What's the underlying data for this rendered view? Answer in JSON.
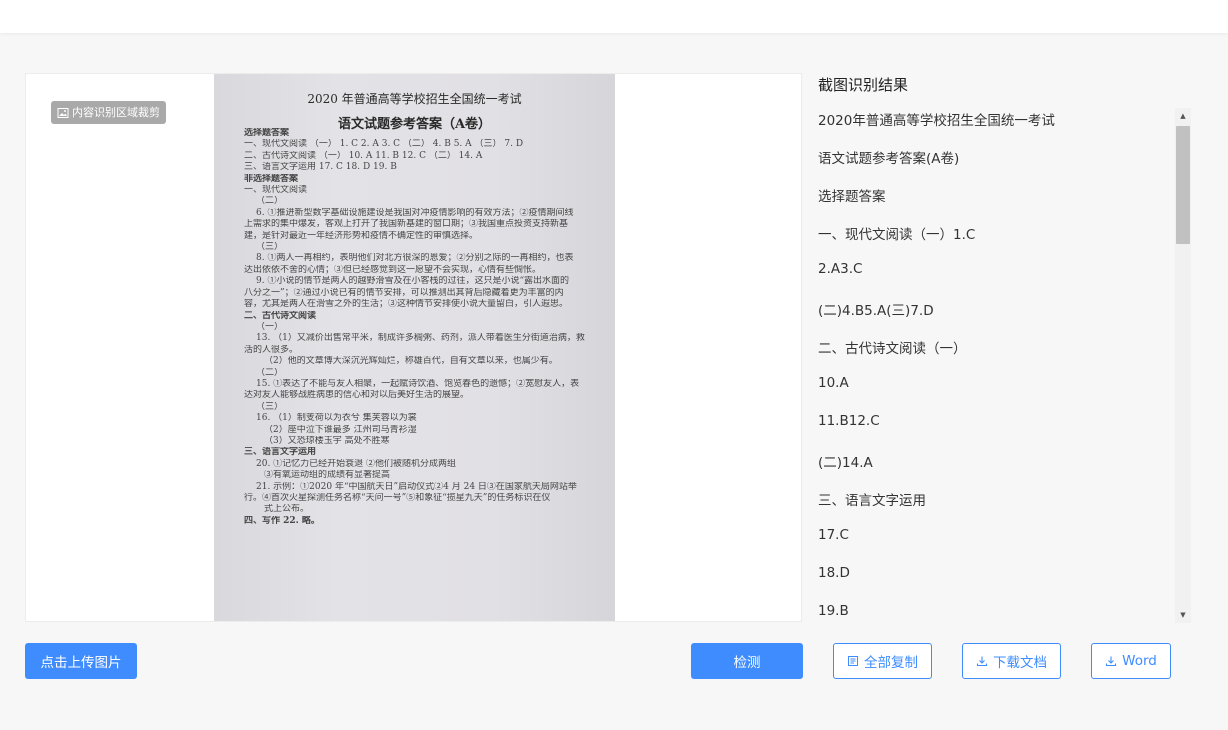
{
  "crop_badge": {
    "label": "内容识别区域裁剪",
    "icon": "image-icon"
  },
  "paper": {
    "title_1": "2020 年普通高等学校招生全国统一考试",
    "title_2": "语文试题参考答案（A卷）",
    "lines": [
      {
        "text": "选择题答案",
        "style": "h"
      },
      {
        "text": "一、现代文阅读 （一） 1. C   2. A   3. C   （二） 4. B   5. A     （三） 7. D",
        "style": ""
      },
      {
        "text": "二、古代诗文阅读 （一） 10. A     11. B     12. C     （二） 14. A",
        "style": ""
      },
      {
        "text": "三、语言文字运用   17. C       18. D       19. B",
        "style": ""
      },
      {
        "text": "非选择题答案",
        "style": "h"
      },
      {
        "text": "一、现代文阅读",
        "style": ""
      },
      {
        "text": "（二）",
        "style": "i1"
      },
      {
        "text": "6. ①推进新型数字基础设施建设是我国对冲疫情影响的有效方法；②疫情期间线",
        "style": "i1"
      },
      {
        "text": "上需求的集中爆发，客观上打开了我国新基建的窗口期；③我国重点投资支持新基",
        "style": ""
      },
      {
        "text": "建，是针对最近一年经济形势和疫情不确定性的审慎选择。",
        "style": ""
      },
      {
        "text": "（三）",
        "style": "i1"
      },
      {
        "text": "8. ①两人一再相约，表明他们对北方很深的恩爱；②分别之际的一再相约，也表",
        "style": "i1"
      },
      {
        "text": "达出依依不舍的心情；③但已经感觉到这一愿望不会实现，心情有些惆怅。",
        "style": ""
      },
      {
        "text": "9. ①小说的情节是两人的越野滑雪及在小客栈的过往，这只是小说“露出水面的",
        "style": "i1"
      },
      {
        "text": "八分之一”；②通过小说已有的情节安排，可以推测出其背后隐藏着更为丰富的内",
        "style": ""
      },
      {
        "text": "容，尤其是两人在滑雪之外的生活；③这种情节安排使小说大量留白，引人遐思。",
        "style": ""
      },
      {
        "text": "二、古代诗文阅读",
        "style": "h"
      },
      {
        "text": "（一）",
        "style": "i1"
      },
      {
        "text": "13. （1）又减价出售常平米，制成许多稠粥、药剂，派人带着医生分街道治病，救",
        "style": "i1"
      },
      {
        "text": "活的人很多。",
        "style": ""
      },
      {
        "text": "（2）他的文章博大深沉光辉灿烂，称雄百代，自有文章以来，也属少有。",
        "style": "i2"
      },
      {
        "text": "（二）",
        "style": "i1"
      },
      {
        "text": "15. ①表达了不能与友人相聚，一起赋诗饮酒、饱览春色的遗憾；②宽慰友人，表",
        "style": "i1"
      },
      {
        "text": "达对友人能够战胜病患的信心和对以后美好生活的展望。",
        "style": ""
      },
      {
        "text": "（三）",
        "style": "i1"
      },
      {
        "text": "16. （1）制芰荷以为衣兮        集芙蓉以为裳",
        "style": "i1"
      },
      {
        "text": "（2）座中泣下谁最多        江州司马青衫湿",
        "style": "i2"
      },
      {
        "text": "（3）又恐琼楼玉宇          高处不胜寒",
        "style": "i2"
      },
      {
        "text": "三、语言文字运用",
        "style": "h"
      },
      {
        "text": "20. ①记忆力已经开始衰退      ②他们被随机分成两组",
        "style": "i1"
      },
      {
        "text": "③有氧运动组的成绩有显著提高",
        "style": "i2"
      },
      {
        "text": "21. 示例：①2020 年“中国航天日”启动仪式②4 月 24 日③在国家航天局网站举",
        "style": "i1"
      },
      {
        "text": "行。④首次火星探测任务名称“天问一号”⑤和象征“揽星九天”的任务标识在仪",
        "style": ""
      },
      {
        "text": "式上公布。",
        "style": "i2"
      },
      {
        "text": "四、写作   22. 略。",
        "style": "h"
      }
    ]
  },
  "result": {
    "title": "截图识别结果",
    "items": [
      "2020年普通高等学校招生全国统一考试",
      "语文试题参考答案(A卷)",
      "选择题答案",
      "一、现代文阅读（一）1.C",
      "2.A3.C",
      "(二)4.B5.A(三)7.D",
      "二、古代诗文阅读（一）",
      "10.A",
      "11.B12.C",
      "(二)14.A",
      "三、语言文字运用",
      "17.C",
      "18.D",
      "19.B"
    ]
  },
  "buttons": {
    "upload": "点击上传图片",
    "detect": "检测",
    "copy_all": "全部复制",
    "download_doc": "下载文档",
    "word": "Word"
  },
  "colors": {
    "primary": "#3f8cff",
    "badge": "#a9a9a9",
    "background": "#f7f7f8"
  },
  "icons": {
    "copy": "copy-icon",
    "download": "download-icon"
  }
}
